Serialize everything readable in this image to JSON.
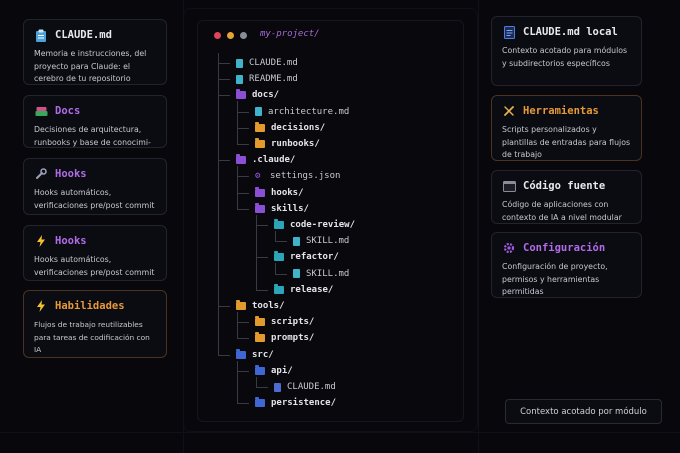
{
  "left_cards": [
    {
      "title": "CLAUDE.md",
      "desc": "Memoria e instrucciones, del proyecto para Claude: el cerebro de tu repositorio",
      "title_color": "#e8e8ee",
      "icon": "clipboard-icon"
    },
    {
      "title": "Docs",
      "desc": "Decisiones de arquitectura, runbooks y base de conocimi-",
      "title_color": "#b06ce8",
      "icon": "book-icon"
    },
    {
      "title": "Hooks",
      "desc": "Hooks automáticos, verificaciones pre/post commit",
      "title_color": "#b06ce8",
      "icon": "wrench-icon"
    },
    {
      "title": "Hooks",
      "desc": "Hooks automáticos, verificaciones pre/post commit",
      "title_color": "#b06ce8",
      "icon": "lightning-icon"
    },
    {
      "title": "Habilidades",
      "desc": "Flujos de trabajo reutilizables para tareas de codificación con IA",
      "title_color": "#e79a3a",
      "icon": "lightning-icon"
    }
  ],
  "right_cards": [
    {
      "title": "CLAUDE.md local",
      "desc": "Contexto acotado para módulos y subdirectorios específicos",
      "title_color": "#e8e8ee",
      "icon": "file-icon"
    },
    {
      "title": "Herramientas",
      "desc": "Scripts personalizados y plantillas de entradas para flujos de trabajo",
      "title_color": "#e79a3a",
      "icon": "tools-icon"
    },
    {
      "title": "Código fuente",
      "desc": "Código de aplicaciones con contexto de IA a nivel modular",
      "title_color": "#e8e8ee",
      "icon": "terminal-icon"
    },
    {
      "title": "Configuración",
      "desc": "Configuración de proyecto, permisos y herramientas permitidas",
      "title_color": "#b06ce8",
      "icon": "gear-icon"
    }
  ],
  "tree": {
    "project": "my-project/",
    "items": [
      {
        "label": "CLAUDE.md",
        "kind": "file",
        "color": "teal",
        "depth": 0
      },
      {
        "label": "README.md",
        "kind": "file",
        "color": "teal",
        "depth": 0
      },
      {
        "label": "docs/",
        "kind": "folder",
        "color": "purple",
        "depth": 0
      },
      {
        "label": "architecture.md",
        "kind": "file",
        "color": "teal",
        "depth": 1
      },
      {
        "label": "decisions/",
        "kind": "folder",
        "color": "orange",
        "depth": 1
      },
      {
        "label": "runbooks/",
        "kind": "folder",
        "color": "orange",
        "depth": 1
      },
      {
        "label": ".claude/",
        "kind": "folder",
        "color": "purple",
        "depth": 0
      },
      {
        "label": "settings.json",
        "kind": "gear",
        "color": "purple",
        "depth": 1
      },
      {
        "label": "hooks/",
        "kind": "folder",
        "color": "purple",
        "depth": 1
      },
      {
        "label": "skills/",
        "kind": "folder",
        "color": "purple",
        "depth": 1
      },
      {
        "label": "code-review/",
        "kind": "folder",
        "color": "teal",
        "depth": 2
      },
      {
        "label": "SKILL.md",
        "kind": "file",
        "color": "teal",
        "depth": 3
      },
      {
        "label": "refactor/",
        "kind": "folder",
        "color": "teal",
        "depth": 2
      },
      {
        "label": "SKILL.md",
        "kind": "file",
        "color": "teal",
        "depth": 3
      },
      {
        "label": "release/",
        "kind": "folder",
        "color": "teal",
        "depth": 2
      },
      {
        "label": "tools/",
        "kind": "folder",
        "color": "orange",
        "depth": 0
      },
      {
        "label": "scripts/",
        "kind": "folder",
        "color": "orange",
        "depth": 1
      },
      {
        "label": "prompts/",
        "kind": "folder",
        "color": "orange",
        "depth": 1
      },
      {
        "label": "src/",
        "kind": "folder",
        "color": "blue",
        "depth": 0
      },
      {
        "label": "api/",
        "kind": "folder",
        "color": "blue",
        "depth": 1
      },
      {
        "label": "CLAUDE.md",
        "kind": "filedark",
        "color": "blue",
        "depth": 2
      },
      {
        "label": "persistence/",
        "kind": "folder",
        "color": "blue",
        "depth": 1
      }
    ]
  },
  "footer": "Contexto acotado por módulo",
  "colors": {
    "red_dot": "#e0445a",
    "yellow_dot": "#e5a534",
    "gray_dot": "#8a8d99"
  }
}
